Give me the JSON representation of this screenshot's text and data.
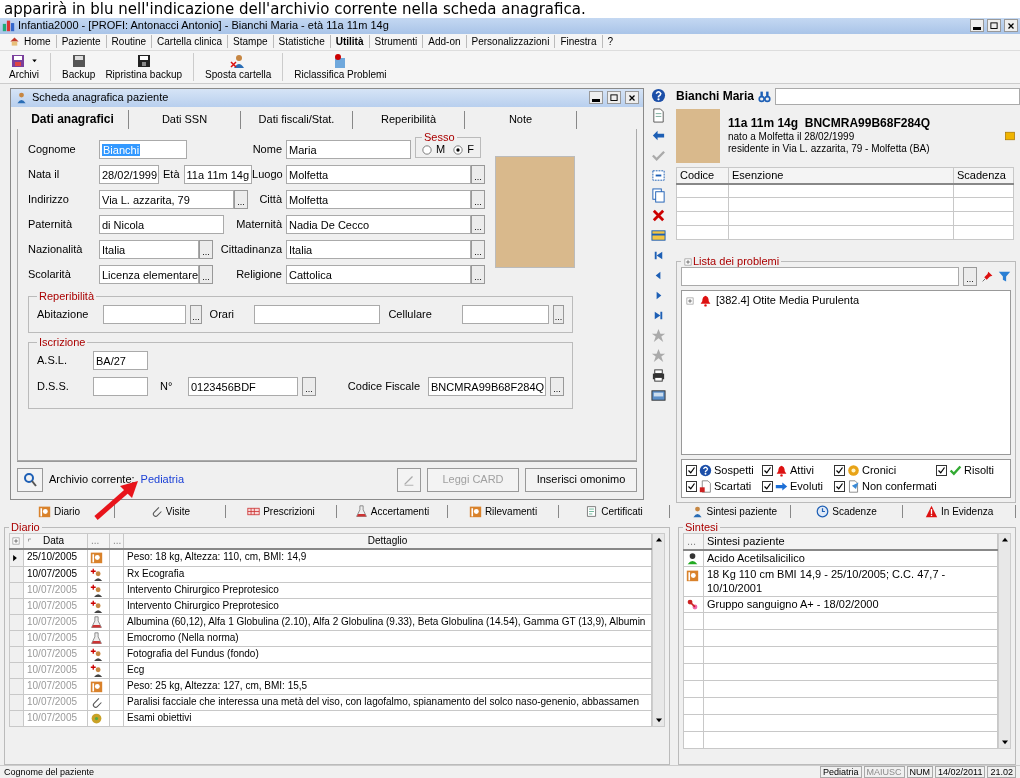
{
  "caption": "apparirà in blu nell'indicazione dell'archivio corrente nella scheda anagrafica.",
  "window": {
    "title": "Infantia2000 - [PROFI: Antonacci Antonio] - Bianchi Maria - età 11a 11m 14g"
  },
  "menu": [
    {
      "label": "Home",
      "selected": false
    },
    {
      "label": "Paziente",
      "selected": false
    },
    {
      "label": "Routine",
      "selected": false
    },
    {
      "label": "Cartella clinica",
      "selected": false
    },
    {
      "label": "Stampe",
      "selected": false
    },
    {
      "label": "Statistiche",
      "selected": false
    },
    {
      "label": "Utilità",
      "selected": true
    },
    {
      "label": "Strumenti",
      "selected": false
    },
    {
      "label": "Add-on",
      "selected": false
    },
    {
      "label": "Personalizzazioni",
      "selected": false
    },
    {
      "label": "Finestra",
      "selected": false
    },
    {
      "label": "?",
      "selected": false
    }
  ],
  "toolbar": [
    {
      "label": "Archivi",
      "kind": "dropdown"
    },
    {
      "label": "Backup",
      "kind": "button"
    },
    {
      "label": "Ripristina backup",
      "kind": "button"
    },
    {
      "label": "Sposta cartella",
      "kind": "button"
    },
    {
      "label": "Riclassifica Problemi",
      "kind": "button"
    }
  ],
  "form": {
    "title": "Scheda anagrafica paziente",
    "tabs": [
      {
        "label": "Dati anagrafici",
        "selected": true
      },
      {
        "label": "Dati SSN",
        "selected": false
      },
      {
        "label": "Dati fiscali/Stat.",
        "selected": false
      },
      {
        "label": "Reperibilità",
        "selected": false
      },
      {
        "label": "Note",
        "selected": false
      }
    ],
    "rows": [
      {
        "fields": [
          {
            "label": "Cognome",
            "value": "Bianchi",
            "focused": true
          },
          {
            "label": "Nome",
            "value": "Maria",
            "focused": false
          }
        ]
      },
      {
        "fields": [
          {
            "label": "Nata il",
            "value": "28/02/1999",
            "focused": false
          },
          {
            "label": "Età",
            "value": "11a 11m 14g",
            "focused": false
          },
          {
            "label": "Luogo",
            "value": "Molfetta",
            "focused": false,
            "button": "..."
          }
        ]
      },
      {
        "fields": [
          {
            "label": "Indirizzo",
            "value": "Via L. azzarita, 79",
            "focused": false,
            "button": "..."
          },
          {
            "label": "Città",
            "value": "Molfetta",
            "focused": false,
            "button": "..."
          }
        ]
      },
      {
        "fields": [
          {
            "label": "Paternità",
            "value": "di Nicola",
            "focused": false
          },
          {
            "label": "Maternità",
            "value": "Nadia De Cecco",
            "focused": false,
            "button": "..."
          }
        ]
      },
      {
        "fields": [
          {
            "label": "Nazionalità",
            "value": "Italia",
            "focused": false,
            "button": "..."
          },
          {
            "label": "Cittadinanza",
            "value": "Italia",
            "focused": false,
            "button": "..."
          }
        ]
      },
      {
        "fields": [
          {
            "label": "Scolarità",
            "value": "Licenza elementare",
            "focused": false,
            "button": "..."
          },
          {
            "label": "Religione",
            "value": "Cattolica",
            "focused": false,
            "button": "..."
          }
        ]
      }
    ],
    "sex": {
      "label": "Sesso",
      "options": [
        {
          "label": "M",
          "selected": false
        },
        {
          "label": "F",
          "selected": true
        }
      ]
    },
    "contacts": {
      "title": "Reperibilità",
      "fields": [
        {
          "label": "Abitazione",
          "button": "..."
        },
        {
          "label": "Orari"
        },
        {
          "label": "Cellulare",
          "button": "..."
        }
      ]
    },
    "registration": {
      "title": "Iscrizione",
      "rows": [
        {
          "fields": [
            {
              "label": "A.S.L.",
              "value": "BA/27"
            }
          ]
        },
        {
          "fields": [
            {
              "label": "D.S.S."
            },
            {
              "label": "N°",
              "value": "0123456BDF",
              "button": "..."
            },
            {
              "label": "Codice Fiscale",
              "value": "BNCMRA99B68F284Q",
              "button": "..."
            }
          ]
        }
      ]
    },
    "footer": {
      "label": "Archivio corrente:",
      "archive": "Pediatria",
      "icon_button_disabled": true,
      "buttons": [
        {
          "label": "Leggi CARD",
          "disabled": true
        },
        {
          "label": "Inserisci omonimo",
          "disabled": false
        }
      ]
    }
  },
  "patient": {
    "name": "Bianchi Maria",
    "headline": "11a 11m 14g  BNCMRA99B68F284Q",
    "lines": [
      "nato a Molfetta il 28/02/1999",
      "residente in Via L. azzarita, 79 - Molfetta (BA)"
    ]
  },
  "exemptions": {
    "columns": [
      "Codice",
      "Esenzione",
      "Scadenza"
    ]
  },
  "problems": {
    "title": "Lista dei problemi",
    "button": "...",
    "items": [
      {
        "label": "[382.4] Otite Media Purulenta",
        "expanded": false
      }
    ],
    "filters": [
      {
        "label": "Sospetti",
        "checked": true,
        "kind": "suspected"
      },
      {
        "label": "Attivi",
        "checked": true,
        "kind": "active"
      },
      {
        "label": "Cronici",
        "checked": true,
        "kind": "chronic"
      },
      {
        "label": "Risolti",
        "checked": true,
        "kind": "resolved"
      },
      {
        "label": "Scartati",
        "checked": true,
        "kind": "discarded"
      },
      {
        "label": "Evoluti",
        "checked": true,
        "kind": "evolved"
      },
      {
        "label": "Non confermati",
        "checked": true,
        "kind": "unconfirmed"
      }
    ]
  },
  "bottom_tabs": [
    {
      "label": "Diario",
      "kind": "diary"
    },
    {
      "label": "Visite",
      "kind": "visit"
    },
    {
      "label": "Prescrizioni",
      "kind": "prescription"
    },
    {
      "label": "Accertamenti",
      "kind": "lab"
    },
    {
      "label": "Rilevamenti",
      "kind": "measure"
    },
    {
      "label": "Certificati",
      "kind": "certificate"
    }
  ],
  "diary": {
    "title": "Diario",
    "columns": [
      "Data",
      "...",
      "...",
      "Dettaglio"
    ],
    "rows": [
      {
        "date": "25/10/2005",
        "dimmed": false,
        "current": true,
        "kind": "measure",
        "detail": "Peso: 18 kg, Altezza: 110, cm, BMI: 14,9"
      },
      {
        "date": "10/07/2005",
        "dimmed": false,
        "current": false,
        "kind": "specialist",
        "detail": "Rx Ecografia"
      },
      {
        "date": "10/07/2005",
        "dimmed": true,
        "current": false,
        "kind": "specialist",
        "detail": "Intervento Chirurgico Preprotesico"
      },
      {
        "date": "10/07/2005",
        "dimmed": true,
        "current": false,
        "kind": "specialist",
        "detail": "Intervento Chirurgico Preprotesico"
      },
      {
        "date": "10/07/2005",
        "dimmed": true,
        "current": false,
        "kind": "lab",
        "detail": "Albumina (60,12), Alfa 1 Globulina (2.10), Alfa 2 Globulina (9.33), Beta Globulina (14.54), Gamma GT (13,9), Albumin"
      },
      {
        "date": "10/07/2005",
        "dimmed": true,
        "current": false,
        "kind": "lab",
        "detail": "Emocromo (Nella norma)"
      },
      {
        "date": "10/07/2005",
        "dimmed": true,
        "current": false,
        "kind": "specialist",
        "detail": "Fotografia del Fundus (fondo)"
      },
      {
        "date": "10/07/2005",
        "dimmed": true,
        "current": false,
        "kind": "specialist",
        "detail": "Ecg"
      },
      {
        "date": "10/07/2005",
        "dimmed": true,
        "current": false,
        "kind": "measure",
        "detail": "Peso: 25 kg, Altezza: 127, cm, BMI: 15,5"
      },
      {
        "date": "10/07/2005",
        "dimmed": true,
        "current": false,
        "kind": "visit",
        "detail": "Paralisi facciale che interessa una metà del viso, con lagofalmo, spianamento del solco naso-genenio, abbassamen"
      },
      {
        "date": "10/07/2005",
        "dimmed": true,
        "current": false,
        "kind": "exam",
        "detail": "Esami obiettivi"
      }
    ]
  },
  "side_tabs": [
    {
      "label": "Sintesi paziente",
      "kind": "person"
    },
    {
      "label": "Scadenze",
      "kind": "clock"
    },
    {
      "label": "In Evidenza",
      "kind": "warning"
    }
  ],
  "summary": {
    "title": "Sintesi",
    "columns": [
      "...",
      "Sintesi paziente"
    ],
    "rows": [
      {
        "kind": "drug",
        "text": "Acido Acetilsalicilico"
      },
      {
        "kind": "measure",
        "text": "18 Kg 110 cm BMI 14,9 - 25/10/2005; C.C. 47,7 - 10/10/2001"
      },
      {
        "kind": "blood",
        "text": "Gruppo sanguigno A+ - 18/02/2000"
      }
    ]
  },
  "status_bar": {
    "hint": "Cognome del paziente",
    "panels": [
      {
        "label": "Pediatria",
        "disabled": false
      },
      {
        "label": "MAIUSC",
        "disabled": true
      },
      {
        "label": "NUM",
        "disabled": false
      },
      {
        "label": "14/02/2011",
        "disabled": false
      },
      {
        "label": "21.02",
        "disabled": false
      }
    ]
  }
}
